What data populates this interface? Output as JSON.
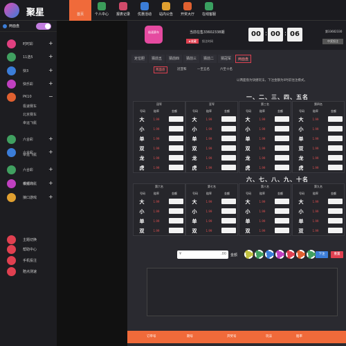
{
  "app": {
    "name": "聚星"
  },
  "nav": [
    {
      "label": "首页",
      "color": "#f06a3a",
      "active": true
    },
    {
      "label": "个人中心",
      "color": "#3b9c5a"
    },
    {
      "label": "报表记录",
      "color": "#d04a6a"
    },
    {
      "label": "优惠活动",
      "color": "#3b7dd8"
    },
    {
      "label": "站内公告",
      "color": "#e0a030"
    },
    {
      "label": "开奖大厅",
      "color": "#e06030"
    },
    {
      "label": "在线客服",
      "color": "#3aa060"
    }
  ],
  "sidebar": {
    "top_label": "两面盘",
    "items": [
      {
        "label": "时时彩",
        "color": "#e04080",
        "exp": "+"
      },
      {
        "label": "11选5",
        "color": "#40a060",
        "exp": "+"
      },
      {
        "label": "快3",
        "color": "#3b7dd8",
        "exp": "+"
      },
      {
        "label": "快乐彩",
        "color": "#c040c0",
        "exp": "+"
      },
      {
        "label": "PK10",
        "color": "#e06030",
        "exp": "−"
      },
      {
        "label": "六合彩",
        "color": "#40a060",
        "exp": "+"
      },
      {
        "label": "六合彩",
        "color": "#3b7dd8",
        "exp": "+"
      },
      {
        "label": "六合彩",
        "color": "#40a060",
        "exp": "+"
      },
      {
        "label": "低频彩",
        "color": "#c040c0",
        "exp": "+"
      },
      {
        "label": "接口游戏",
        "color": "#e0a030",
        "exp": "+"
      },
      {
        "label": "主题切换",
        "color": "#e04050",
        "exp": ""
      },
      {
        "label": "帮助中心",
        "color": "#e04050",
        "exp": ""
      },
      {
        "label": "手机投注",
        "color": "#e04050",
        "exp": ""
      },
      {
        "label": "赔点测速",
        "color": "#e04050",
        "exp": ""
      }
    ],
    "pk10_sub": [
      "极速赛车",
      "北京赛车",
      "幸运飞艇"
    ],
    "sub2": [
      "幸运飞艇"
    ],
    "sub3": [
      "幸运飞艇"
    ]
  },
  "header": {
    "game_icon_text": "极速赛车",
    "issue_text": "当前在售33602338期",
    "fav_label": "★收藏",
    "ok_label": "投注时间",
    "countdown": [
      "00",
      "00",
      "06"
    ],
    "right_issue": "第33602330",
    "right_btn": "中奖投注"
  },
  "tabs": [
    "定位胆",
    "猜前五",
    "猜前四",
    "猜前三",
    "猜前二",
    "猜冠军",
    "两面盘"
  ],
  "subtabs": [
    "两面盘",
    "冠亚和",
    "一至五名",
    "六至十名"
  ],
  "note": "以两面盘为快捷玩法，下注金额为0时前往注模式。",
  "section1_title": "一、二、三、四、五名",
  "section2_title": "六、七、八、九、十名",
  "col_headers": {
    "num": "号码",
    "odds": "赔率",
    "amount": "金额"
  },
  "group1_titles": [
    "冠军",
    "亚军",
    "第三名",
    "第四名"
  ],
  "group2_titles": [
    "第六名",
    "第七名",
    "第八名",
    "第九名"
  ],
  "rows1": [
    "大",
    "小",
    "单",
    "双",
    "龙",
    "虎"
  ],
  "rows2": [
    "大",
    "小",
    "单",
    "双"
  ],
  "odds": "1.99",
  "bet": {
    "currency": "¥",
    "decimal": ".00",
    "amount_label": "金额",
    "submit": "下注",
    "reset": "重置"
  },
  "chips": [
    "#c0c040",
    "#40a060",
    "#3b7dd8",
    "#c040c0",
    "#e04050",
    "#e06030",
    "#40a060"
  ],
  "footer_cols": [
    "订单号",
    "期号",
    "开奖号",
    "玩法",
    "赔率"
  ]
}
